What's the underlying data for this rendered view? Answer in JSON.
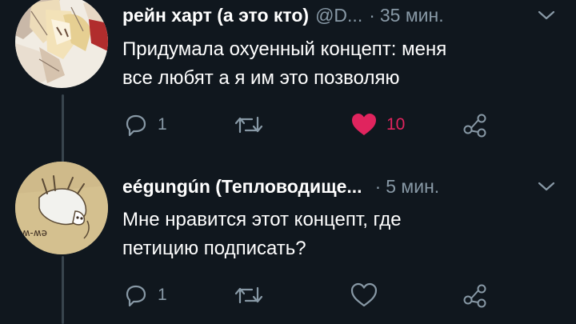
{
  "tweets": [
    {
      "author_name": "рейн харт (а это кто)",
      "handle": "@D...",
      "separator": "·",
      "time": "35 мин.",
      "text_line1": "Придумала охуенный концепт: меня",
      "text_line2": "все любят а я им это позволяю",
      "reply_count": "1",
      "retweet_count": "",
      "like_count": "10",
      "liked": true
    },
    {
      "author_name": "eégungún (Тепловодище...",
      "handle": "",
      "separator": "·",
      "time": "5 мин.",
      "text_line1": "Мне нравится этот концепт, где",
      "text_line2": "петицию подписать?",
      "reply_count": "1",
      "retweet_count": "",
      "like_count": "",
      "liked": false
    }
  ],
  "icons": {
    "reply": "reply-icon",
    "retweet": "retweet-icon",
    "like": "heart-icon",
    "share": "share-icon",
    "menu": "chevron-down-icon"
  },
  "colors": {
    "background": "#10171e",
    "secondary_text": "#8899a6",
    "like_active": "#e0245e",
    "thread_line": "#38444d"
  }
}
